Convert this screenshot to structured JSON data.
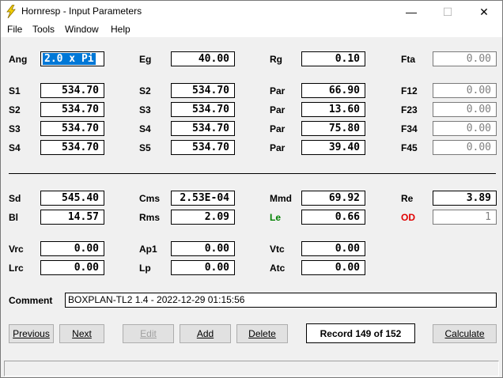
{
  "window": {
    "title": "Hornresp - Input Parameters",
    "minimize_glyph": "—",
    "maximize_glyph": "☐",
    "close_glyph": "✕"
  },
  "menu": {
    "file": "File",
    "tools": "Tools",
    "window": "Window",
    "help": "Help"
  },
  "params": {
    "ang": {
      "label": "Ang",
      "value": "2.0 x Pi"
    },
    "eg": {
      "label": "Eg",
      "value": "40.00"
    },
    "rg": {
      "label": "Rg",
      "value": "0.10"
    },
    "fta": {
      "label": "Fta",
      "value": "0.00"
    },
    "s1": {
      "label": "S1",
      "value": "534.70"
    },
    "s2a": {
      "label": "S2",
      "value": "534.70"
    },
    "par1": {
      "label": "Par",
      "value": "66.90"
    },
    "f12": {
      "label": "F12",
      "value": "0.00"
    },
    "s2": {
      "label": "S2",
      "value": "534.70"
    },
    "s3a": {
      "label": "S3",
      "value": "534.70"
    },
    "par2": {
      "label": "Par",
      "value": "13.60"
    },
    "f23": {
      "label": "F23",
      "value": "0.00"
    },
    "s3": {
      "label": "S3",
      "value": "534.70"
    },
    "s4a": {
      "label": "S4",
      "value": "534.70"
    },
    "par3": {
      "label": "Par",
      "value": "75.80"
    },
    "f34": {
      "label": "F34",
      "value": "0.00"
    },
    "s4": {
      "label": "S4",
      "value": "534.70"
    },
    "s5": {
      "label": "S5",
      "value": "534.70"
    },
    "par4": {
      "label": "Par",
      "value": "39.40"
    },
    "f45": {
      "label": "F45",
      "value": "0.00"
    },
    "sd": {
      "label": "Sd",
      "value": "545.40"
    },
    "cms": {
      "label": "Cms",
      "value": "2.53E-04"
    },
    "mmd": {
      "label": "Mmd",
      "value": "69.92"
    },
    "re": {
      "label": "Re",
      "value": "3.89"
    },
    "bl": {
      "label": "Bl",
      "value": "14.57"
    },
    "rms": {
      "label": "Rms",
      "value": "2.09"
    },
    "le": {
      "label": "Le",
      "value": "0.66"
    },
    "od": {
      "label": "OD",
      "value": "1"
    },
    "vrc": {
      "label": "Vrc",
      "value": "0.00"
    },
    "ap1": {
      "label": "Ap1",
      "value": "0.00"
    },
    "vtc": {
      "label": "Vtc",
      "value": "0.00"
    },
    "lrc": {
      "label": "Lrc",
      "value": "0.00"
    },
    "lp": {
      "label": "Lp",
      "value": "0.00"
    },
    "atc": {
      "label": "Atc",
      "value": "0.00"
    }
  },
  "comment": {
    "label": "Comment",
    "value": "BOXPLAN-TL2 1.4 - 2022-12-29 01:15:56"
  },
  "buttons": {
    "previous": "Previous",
    "next": "Next",
    "edit": "Edit",
    "add": "Add",
    "delete": "Delete",
    "calculate": "Calculate"
  },
  "record": "Record 149 of 152",
  "colors": {
    "accent_blue": "#0078d7",
    "le_green": "#008000",
    "od_red": "#e00000"
  }
}
